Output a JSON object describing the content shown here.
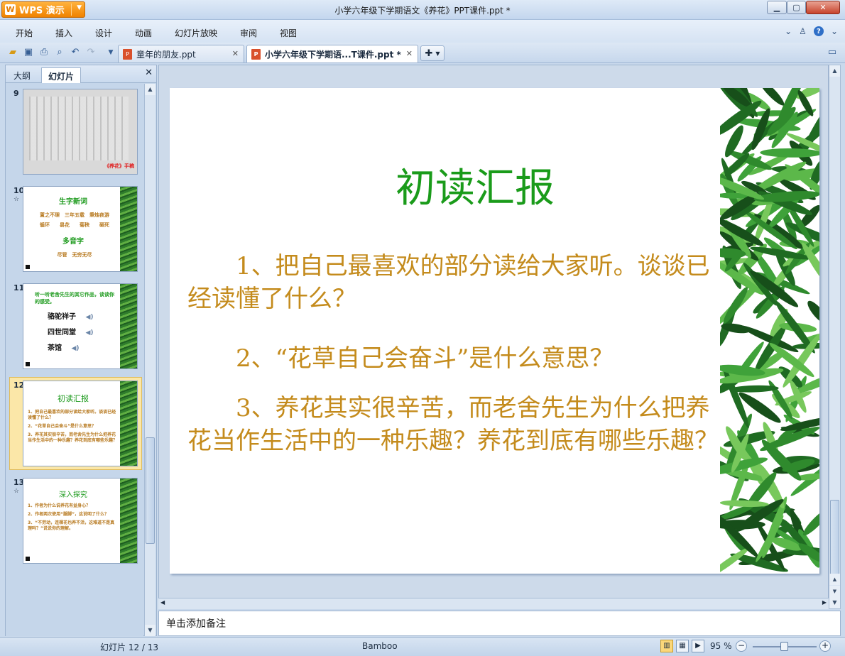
{
  "app": {
    "name": "WPS 演示",
    "window_title": "小学六年级下学期语文《养花》PPT课件.ppt *"
  },
  "colors": {
    "accent": "#f08200",
    "slide_title": "#1a9b1a",
    "slide_text": "#c48b1c",
    "selection": "#fbe7a8"
  },
  "menu": [
    "开始",
    "插入",
    "设计",
    "动画",
    "幻灯片放映",
    "审阅",
    "视图"
  ],
  "tabs": [
    {
      "label": "童年的朋友.ppt",
      "active": false
    },
    {
      "label": "小学六年级下学期语...T课件.ppt *",
      "active": true
    }
  ],
  "panel": {
    "tab_outline": "大纲",
    "tab_slides": "幻灯片"
  },
  "thumbnails": [
    {
      "num": "9",
      "caption": "《养花》手稿"
    },
    {
      "num": "10",
      "title": "生字新词",
      "lines": [
        "置之不理　三年五载　秉烛夜游",
        "循环　　昙花　　菊秧　　砸死"
      ],
      "title2": "多音字",
      "lines2": [
        "尽管　无穷无尽"
      ]
    },
    {
      "num": "11",
      "title": "听一听老舍先生的其它作品，谈谈你的感受。",
      "items": [
        "骆驼祥子",
        "四世同堂",
        "茶馆"
      ]
    },
    {
      "num": "12",
      "title": "初读汇报",
      "lines": [
        "1、把自己最喜欢的部分读给大家听。谈谈已经读懂了什么？",
        "2、“花草自己会奋斗”是什么意思？",
        "3、养花其实很辛苦，而老舍先生为什么把养花当作生活中的一种乐趣？养花到底有哪些乐趣？"
      ]
    },
    {
      "num": "13",
      "title": "深入探究",
      "lines": [
        "1、作者为什么说养花有益身心？",
        "2、作者两次使用“腿脚”，这说明了什么？",
        "3、“不劳动，连棵花也养不活，这难道不是真理吗？”说说你的理解。"
      ]
    }
  ],
  "slide": {
    "title": "初读汇报",
    "paragraphs": [
      "1、把自己最喜欢的部分读给大家听。谈谈已经读懂了什么？",
      "2、“花草自己会奋斗”是什么意思？",
      "3、养花其实很辛苦，而老舍先生为什么把养花当作生活中的一种乐趣？养花到底有哪些乐趣？"
    ]
  },
  "notes_placeholder": "单击添加备注",
  "status": {
    "slide_info": "幻灯片 12 / 13",
    "theme": "Bamboo",
    "zoom": "95 %",
    "zoom_level": 0.5
  }
}
